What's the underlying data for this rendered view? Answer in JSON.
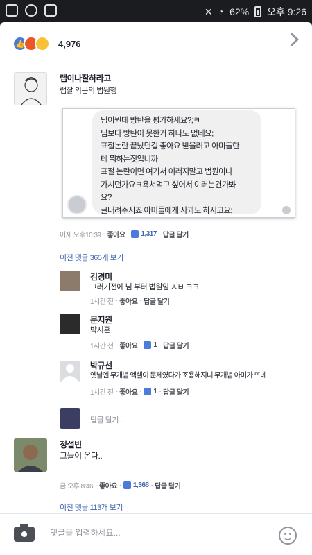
{
  "statusbar": {
    "battery": "62%",
    "time": "오후 9:26"
  },
  "reactions": {
    "count": "4,976",
    "emojis": [
      "like-icon",
      "angry-icon",
      "haha-icon"
    ]
  },
  "colors": {
    "accent": "#4267b2",
    "like": "#4c7bd9",
    "angry": "#e8562a",
    "haha": "#f7c238"
  },
  "main_comment": {
    "author": "랩이나잘하라고",
    "subtitle": "랩잘 의문의 법원행",
    "screenshot_lines": [
      "님이뭔데  방탄을 평가하세요?;ㅋ",
      "님보다 방탄이 못한거 하나도 없네요;",
      "표절논란 끝났던걸 좋아요 받을려고 아미들한",
      "테 뭐하는짓입니까",
      "표절 논란이면 여기서 이러지말고 법원이나",
      "가시던가요ㅋ욕쳐먹고 싶어서 이러는건가봐",
      "요?",
      "글내려주시죠 아미들에게 사과도 하시고요;"
    ],
    "time": "어제 오후10:39",
    "like": "좋아요",
    "likes": "1,317",
    "reply": "답글 달기",
    "more_replies": "이전 댓글 365개 보기"
  },
  "replies": [
    {
      "author": "김경미",
      "text": "그러기전에 님 부터 법원임 ㅅㅂ ㅋㅋ",
      "time": "1시간 전",
      "like": "좋아요",
      "likes": "",
      "reply": "답글 달기"
    },
    {
      "author": "문지원",
      "text": "박지훈",
      "time": "1시간 전",
      "like": "좋아요",
      "likes": "1",
      "reply": "답글 달기"
    },
    {
      "author": "박규선",
      "text": "옛날엔 무개념 엑셀이 문제였다가 조용해지니 무개념 아미가 뜨네",
      "time": "1시간 전",
      "like": "좋아요",
      "likes": "1",
      "reply": "답글 달기"
    }
  ],
  "reply_prompt": "답글 달기...",
  "second_comment": {
    "author": "정설빈",
    "text": "그들이 온다..",
    "time": "금 오후 8:46",
    "like": "좋아요",
    "likes": "1,368",
    "reply": "답글 달기",
    "more_replies": "이전 댓글 113개 보기"
  },
  "composer": {
    "placeholder": "댓글을 입력하세요..."
  }
}
